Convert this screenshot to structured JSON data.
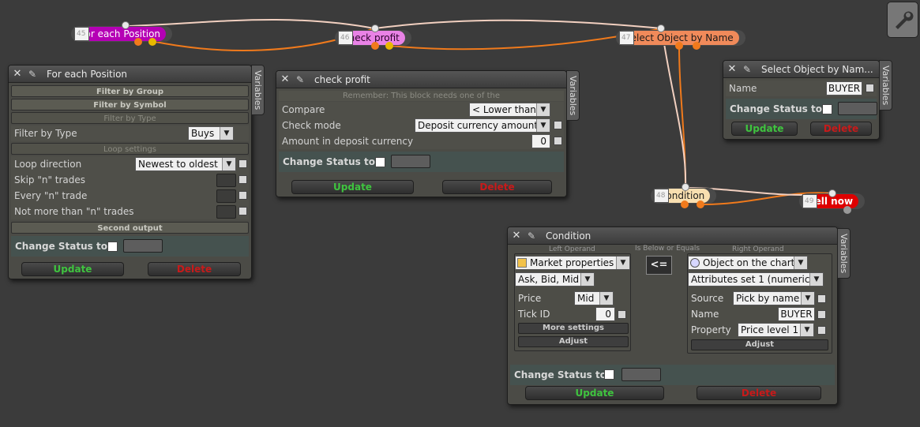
{
  "nodes": [
    {
      "num": "45",
      "label": "For each Position",
      "color": "#b500b5",
      "text": "#ffffff"
    },
    {
      "num": "46",
      "label": "check profit",
      "color": "#e982e6",
      "text": "#2a002a"
    },
    {
      "num": "47",
      "label": "Select Object by Name",
      "color": "#f08a5a",
      "text": "#1a1a1a"
    },
    {
      "num": "48",
      "label": "Condition",
      "color": "#f9dfb0",
      "text": "#1a1a1a"
    },
    {
      "num": "49",
      "label": "Sell now",
      "color": "#dd0000",
      "text": "#ffffff"
    }
  ],
  "win_foreach": {
    "title": "For each Position",
    "variables_tab": "Variables",
    "sections": {
      "filter_group": "Filter by Group",
      "filter_symbol": "Filter by Symbol",
      "filter_type": "Filter by Type",
      "loop": "Loop settings",
      "second": "Second output"
    },
    "filter_type_label": "Filter by Type",
    "filter_type_value": "Buys",
    "loop_direction_label": "Loop direction",
    "loop_direction_value": "Newest to oldest",
    "skip_label": "Skip \"n\" trades",
    "every_label": "Every \"n\" trade",
    "notmore_label": "Not more than \"n\" trades",
    "change_status": "Change Status to",
    "update": "Update",
    "delete": "Delete"
  },
  "win_check": {
    "title": "check profit",
    "variables_tab": "Variables",
    "note": "Remember: This block needs one of the",
    "compare_label": "Compare",
    "compare_value": "< Lower than",
    "mode_label": "Check mode",
    "mode_value": "Deposit currency amount",
    "amount_label": "Amount in deposit currency",
    "amount_value": "0",
    "change_status": "Change Status to",
    "update": "Update",
    "delete": "Delete"
  },
  "win_select": {
    "title": "Select Object by Nam...",
    "variables_tab": "Variables",
    "name_label": "Name",
    "name_value": "BUYER",
    "change_status": "Change Status to",
    "update": "Update",
    "delete": "Delete"
  },
  "win_condition": {
    "title": "Condition",
    "variables_tab": "Variables",
    "left_operand": "Left Operand",
    "op_caption": "Is Below or Equals",
    "right_operand": "Right Operand",
    "operator": "<=",
    "left_source": "Market properties",
    "left_sub": "Ask, Bid, Mid",
    "price_label": "Price",
    "price_value": "Mid",
    "tickid_label": "Tick ID",
    "tickid_value": "0",
    "more_settings": "More settings",
    "adjust_left": "Adjust",
    "right_source": "Object on the chart",
    "right_sub": "Attributes set 1 (numeric)",
    "source_label": "Source",
    "source_value": "Pick by name",
    "name_label": "Name",
    "name_value": "BUYER",
    "property_label": "Property",
    "property_value": "Price level 1",
    "adjust_right": "Adjust",
    "change_status": "Change Status to",
    "update": "Update",
    "delete": "Delete"
  },
  "icons": {
    "close": "close-icon",
    "pin": "pin-icon",
    "tool": "wrench-icon"
  }
}
